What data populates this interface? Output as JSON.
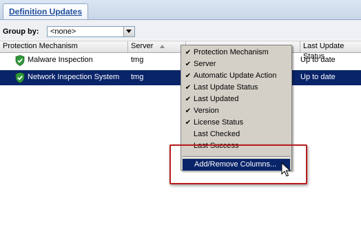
{
  "tab": {
    "label": "Definition Updates"
  },
  "groupby": {
    "label": "Group by:",
    "value": "<none>"
  },
  "columns": [
    "Protection Mechanism",
    "Server",
    "Last Update Status"
  ],
  "rows": [
    {
      "mechanism": "Malware Inspection",
      "server": "tmg",
      "status": "Up to date",
      "selected": false
    },
    {
      "mechanism": "Network Inspection System",
      "server": "tmg",
      "status": "Up to date",
      "selected": true
    }
  ],
  "context_menu": {
    "items": [
      {
        "label": "Protection Mechanism",
        "checked": true
      },
      {
        "label": "Server",
        "checked": true
      },
      {
        "label": "Automatic Update Action",
        "checked": true
      },
      {
        "label": "Last Update Status",
        "checked": true
      },
      {
        "label": "Last Updated",
        "checked": true
      },
      {
        "label": "Version",
        "checked": true
      },
      {
        "label": "License Status",
        "checked": true
      },
      {
        "label": "Last Checked",
        "checked": false
      },
      {
        "label": "Last Success",
        "checked": false
      }
    ],
    "add_remove": "Add/Remove Columns..."
  },
  "colors": {
    "selection": "#0a246a",
    "highlight_box": "#b91c1c",
    "tab_text": "#1f4e9c"
  },
  "icons": {
    "row_icon": "green-shield-check-icon",
    "sort": "sort-ascending-icon",
    "cursor": "mouse-pointer-icon"
  }
}
